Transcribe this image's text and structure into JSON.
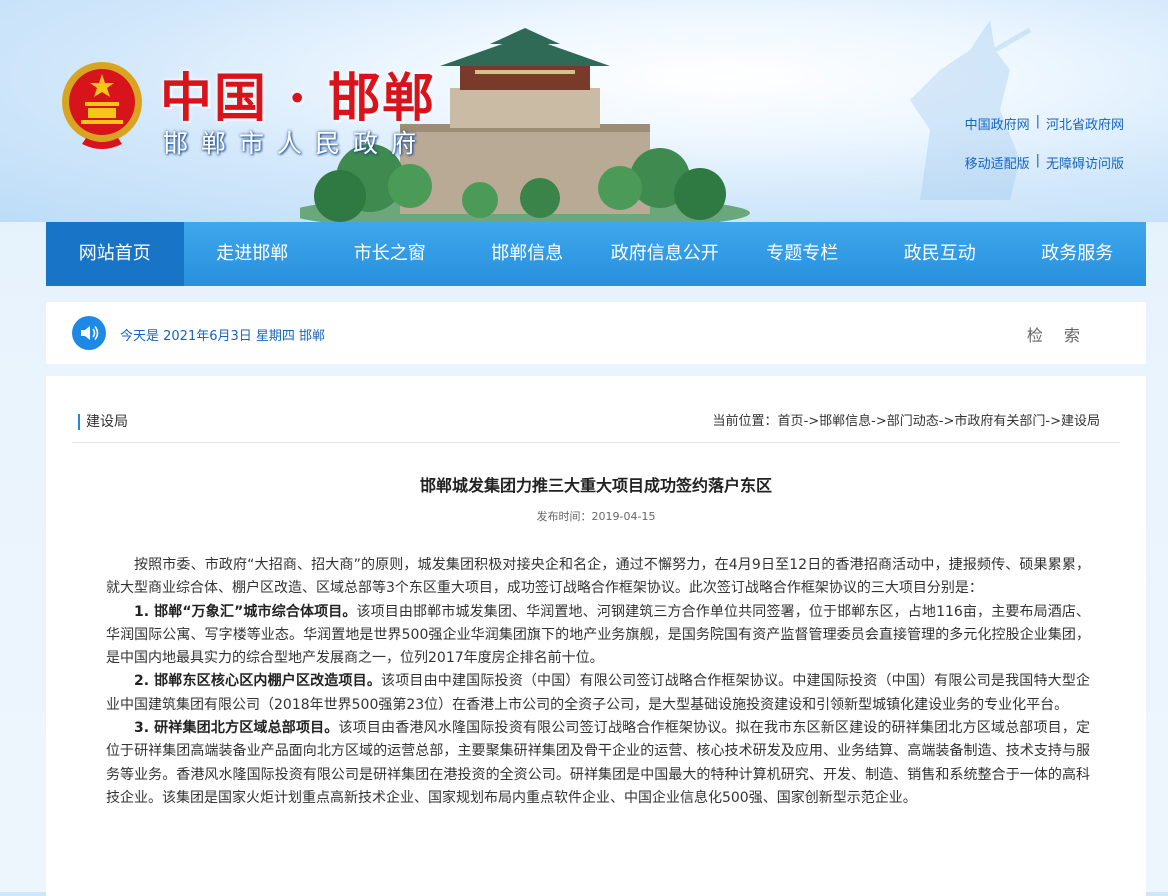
{
  "header": {
    "title_main": "中国 · 邯郸",
    "title_sub": "邯郸市人民政府",
    "links_row1": [
      "中国政府网",
      "河北省政府网"
    ],
    "links_row2": [
      "移动适配版",
      "无障碍访问版"
    ],
    "separator": "|"
  },
  "nav": {
    "items": [
      "网站首页",
      "走进邯郸",
      "市长之窗",
      "邯郸信息",
      "政府信息公开",
      "专题专栏",
      "政民互动",
      "政务服务"
    ],
    "active_index": 0
  },
  "infobar": {
    "date_text": "今天是 2021年6月3日 星期四 邯郸",
    "search_label": "检 索"
  },
  "section": {
    "title": "建设局",
    "breadcrumb_prefix": "当前位置：",
    "breadcrumb": [
      "首页",
      "邯郸信息",
      "部门动态",
      "市政府有关部门",
      "建设局"
    ],
    "breadcrumb_sep": "->"
  },
  "article": {
    "title": "邯郸城发集团力推三大重大项目成功签约落户东区",
    "pubdate": "发布时间：2019-04-15",
    "paragraphs": [
      {
        "lead": "",
        "text": "按照市委、市政府“大招商、招大商”的原则，城发集团积极对接央企和名企，通过不懈努力，在4月9日至12日的香港招商活动中，捷报频传、硕果累累，就大型商业综合体、棚户区改造、区域总部等3个东区重大项目，成功签订战略合作框架协议。此次签订战略合作框架协议的三大项目分别是："
      },
      {
        "lead": "1. 邯郸“万象汇”城市综合体项目。",
        "text": "该项目由邯郸市城发集团、华润置地、河钢建筑三方合作单位共同签署，位于邯郸东区，占地116亩，主要布局酒店、华润国际公寓、写字楼等业态。华润置地是世界500强企业华润集团旗下的地产业务旗舰，是国务院国有资产监督管理委员会直接管理的多元化控股企业集团，是中国内地最具实力的综合型地产发展商之一，位列2017年度房企排名前十位。"
      },
      {
        "lead": "2.  邯郸东区核心区内棚户区改造项目。",
        "text": "该项目由中建国际投资（中国）有限公司签订战略合作框架协议。中建国际投资（中国）有限公司是我国特大型企业中国建筑集团有限公司（2018年世界500强第23位）在香港上市公司的全资子公司，是大型基础设施投资建设和引领新型城镇化建设业务的专业化平台。"
      },
      {
        "lead": "3.  研祥集团北方区域总部项目。",
        "text": "该项目由香港风水隆国际投资有限公司签订战略合作框架协议。拟在我市东区新区建设的研祥集团北方区域总部项目，定位于研祥集团高端装备业产品面向北方区域的运营总部，主要聚集研祥集团及骨干企业的运营、核心技术研发及应用、业务结算、高端装备制造、技术支持与服务等业务。香港风水隆国际投资有限公司是研祥集团在港投资的全资公司。研祥集团是中国最大的特种计算机研究、开发、制造、销售和系统整合于一体的高科技企业。该集团是国家火炬计划重点高新技术企业、国家规划布局内重点软件企业、中国企业信息化500强、国家创新型示范企业。"
      }
    ]
  },
  "colors": {
    "nav_bg": "#2890dc",
    "nav_active": "#1774c7",
    "title_red": "#d7141b",
    "link_blue": "#1565c0"
  },
  "icons": [
    "national-emblem-icon",
    "speaker-icon"
  ]
}
